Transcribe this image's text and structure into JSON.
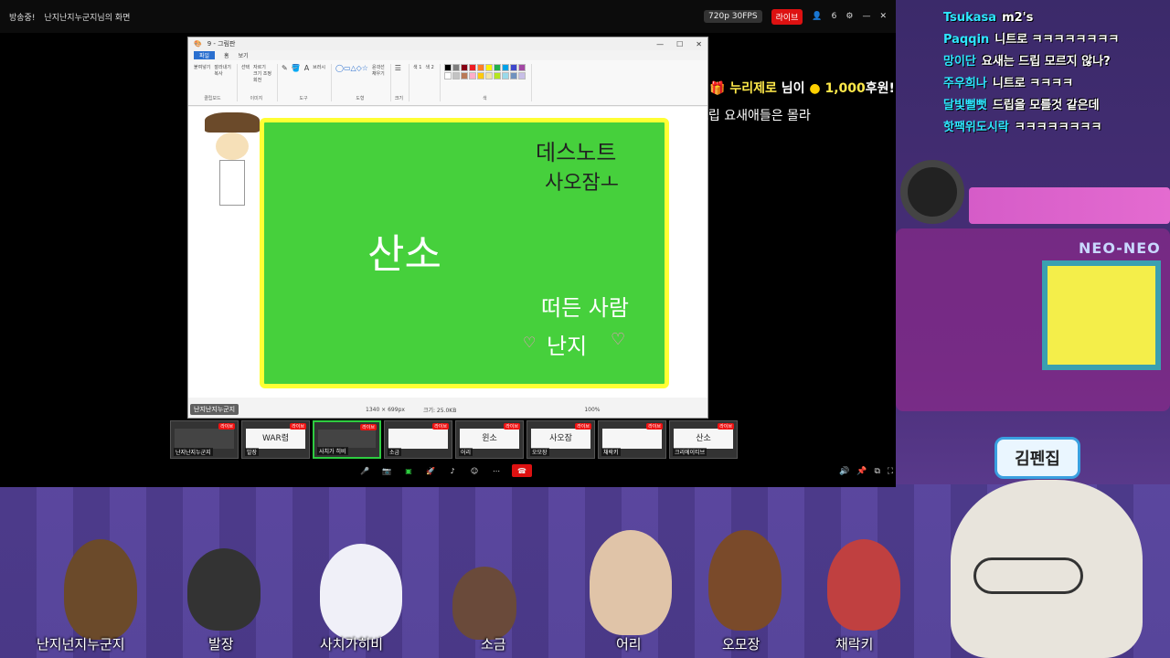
{
  "topbar": {
    "left_label": "방송중!",
    "window_title": "난지난지누군지님의 화면",
    "stats": "720p 30FPS",
    "live": "라이브",
    "viewers": "6"
  },
  "paint": {
    "title": "9 - 그림판",
    "tabs": [
      "파일",
      "홈",
      "보기"
    ],
    "groups": [
      "클립보드",
      "이미지",
      "도구",
      "도형",
      "색"
    ],
    "clipboard": [
      "붙여넣기",
      "잘라내기",
      "복사"
    ],
    "image": [
      "선택",
      "자르기",
      "크기 조정",
      "회전"
    ],
    "tools": [
      "브러시"
    ],
    "shapes": [
      "윤곽선",
      "채우기"
    ],
    "size_label": "크기",
    "color1": "색 1",
    "color2": "색 2",
    "palette": [
      "#000000",
      "#7f7f7f",
      "#880015",
      "#ed1c24",
      "#ff7f27",
      "#fff200",
      "#22b14c",
      "#00a2e8",
      "#3f48cc",
      "#a349a4",
      "#ffffff",
      "#c3c3c3",
      "#b97a57",
      "#ffaec9",
      "#ffc90e",
      "#efe4b0",
      "#b5e61d",
      "#99d9ea",
      "#7092be",
      "#c8bfe7"
    ],
    "canvas_lines": {
      "top_right_1": "데스노트",
      "top_right_2": "사오잠ㅗ",
      "center": "산소",
      "bottom_1": "떠든 사람",
      "bottom_2": "난지"
    },
    "status": {
      "dimensions": "1340 × 699px",
      "size": "크기: 25.0KB",
      "zoom": "100%"
    },
    "owner_chip": "난지난지누군지"
  },
  "thumbs": [
    {
      "name": "난지난지누군지",
      "body": "",
      "dark": true
    },
    {
      "name": "발장",
      "body": "WAR렴",
      "dark": false
    },
    {
      "name": "사치가 히비",
      "body": "",
      "dark": true
    },
    {
      "name": "소금",
      "body": "",
      "dark": false
    },
    {
      "name": "어리",
      "body": "윈소",
      "dark": false
    },
    {
      "name": "오모장",
      "body": "사오잠",
      "dark": false
    },
    {
      "name": "채락키",
      "body": "",
      "dark": false
    },
    {
      "name": "크리에이티브",
      "body": "산소",
      "dark": false
    }
  ],
  "thumb_live": "라이브",
  "chat": [
    {
      "user": "Tsukasa",
      "msg": "m2's"
    },
    {
      "user": "Paqqin",
      "msg": "니트로 ㅋㅋㅋㅋㅋㅋㅋㅋ"
    },
    {
      "user": "망이단",
      "msg": "요새는 드립 모르지 않나?"
    },
    {
      "user": "주우희나",
      "msg": "니트로 ㅋㅋㅋㅋ"
    },
    {
      "user": "달빛뻘뻣",
      "msg": "드립을 모를것 같은데"
    },
    {
      "user": "핫팩위도시락",
      "msg": "ㅋㅋㅋㅋㅋㅋㅋㅋ"
    }
  ],
  "donation": {
    "name": "누리제로",
    "suffix": "님이",
    "amount": "1,000",
    "unit": "후원!"
  },
  "subtitle": "드립 요새애들은 몰라",
  "nametag": "김펜집",
  "cast": [
    "난지넌지누군지",
    "발장",
    "사치가히비",
    "소금",
    "어리",
    "오모장",
    "채락키"
  ],
  "arcade_sign": "NEO-NEO"
}
